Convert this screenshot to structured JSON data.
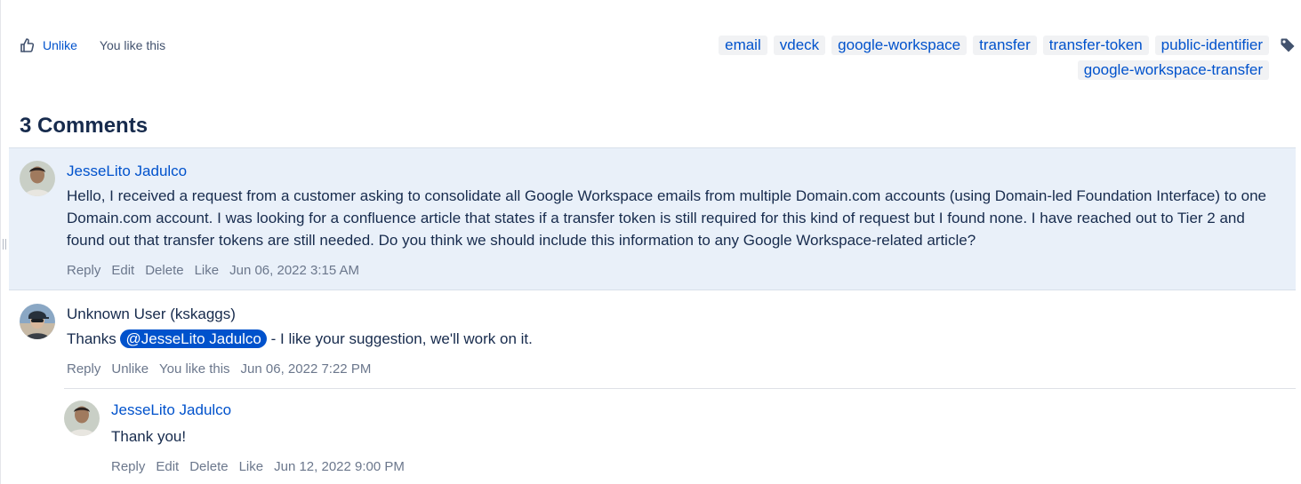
{
  "like_bar": {
    "action": "Unlike",
    "status": "You like this"
  },
  "labels": [
    "email",
    "vdeck",
    "google-workspace",
    "transfer",
    "transfer-token",
    "public-identifier",
    "google-workspace-transfer"
  ],
  "icons": {
    "like": "thumbs-up-icon",
    "labels": "tag-icon"
  },
  "colors": {
    "link": "#0052cc",
    "highlight_bg": "#e9f0f9",
    "mention_bg": "#0052cc",
    "label_bg": "#f1f2f4"
  },
  "comments_heading": "3 Comments",
  "comments": [
    {
      "author": "JesseLito Jadulco",
      "body": "Hello, I received a request from a customer asking to consolidate all Google Workspace emails from multiple Domain.com accounts (using Domain-led Foundation Interface) to one Domain.com account. I was looking for a confluence article that states if a transfer token is still required for this kind of request but I found none. I have reached out to Tier 2 and found out that transfer tokens are still needed. Do you think we should include this information to any Google Workspace-related article?",
      "actions": [
        "Reply",
        "Edit",
        "Delete",
        "Like"
      ],
      "date": "Jun 06, 2022 3:15 AM"
    },
    {
      "author": "Unknown User (kskaggs)",
      "body_prefix": "Thanks",
      "mention": "@JesseLito Jadulco",
      "body_suffix": "- I like your suggestion, we'll work on it.",
      "actions": [
        "Reply",
        "Unlike",
        "You like this"
      ],
      "date": "Jun 06, 2022 7:22 PM"
    },
    {
      "author": "JesseLito Jadulco",
      "body": "Thank you!",
      "actions": [
        "Reply",
        "Edit",
        "Delete",
        "Like"
      ],
      "date": "Jun 12, 2022 9:00 PM"
    }
  ]
}
